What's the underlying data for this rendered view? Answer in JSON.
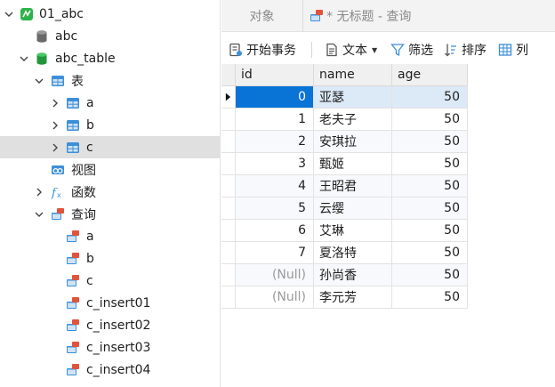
{
  "nav": {
    "items": [
      {
        "label": "01_abc",
        "icon": "connection-icon",
        "indent": 0,
        "expanded": true
      },
      {
        "label": "abc",
        "icon": "database-gray-icon",
        "indent": 1
      },
      {
        "label": "abc_table",
        "icon": "database-green-icon",
        "indent": 1,
        "expanded": true
      },
      {
        "label": "表",
        "icon": "tables-folder-icon",
        "indent": 2,
        "expanded": true
      },
      {
        "label": "a",
        "icon": "table-icon",
        "indent": 3,
        "collapsed": true
      },
      {
        "label": "b",
        "icon": "table-icon",
        "indent": 3,
        "collapsed": true
      },
      {
        "label": "c",
        "icon": "table-icon",
        "indent": 3,
        "collapsed": true,
        "selected": true
      },
      {
        "label": "视图",
        "icon": "views-folder-icon",
        "indent": 2
      },
      {
        "label": "函数",
        "icon": "functions-folder-icon",
        "indent": 2,
        "collapsed": true
      },
      {
        "label": "查询",
        "icon": "queries-folder-icon",
        "indent": 2,
        "expanded": true
      },
      {
        "label": "a",
        "icon": "query-icon",
        "indent": 3
      },
      {
        "label": "b",
        "icon": "query-icon",
        "indent": 3
      },
      {
        "label": "c",
        "icon": "query-icon",
        "indent": 3
      },
      {
        "label": "c_insert01",
        "icon": "query-icon",
        "indent": 3
      },
      {
        "label": "c_insert02",
        "icon": "query-icon",
        "indent": 3
      },
      {
        "label": "c_insert03",
        "icon": "query-icon",
        "indent": 3
      },
      {
        "label": "c_insert04",
        "icon": "query-icon",
        "indent": 3
      }
    ]
  },
  "tabs": {
    "objects": "对象",
    "query": "* 无标题 - 查询"
  },
  "toolbar": {
    "begin_transaction": "开始事务",
    "text": "文本",
    "filter": "筛选",
    "sort": "排序",
    "columns": "列"
  },
  "grid": {
    "columns": [
      "id",
      "name",
      "age"
    ],
    "rows": [
      {
        "id": "0",
        "name": "亚瑟",
        "age": "50"
      },
      {
        "id": "1",
        "name": "老夫子",
        "age": "50"
      },
      {
        "id": "2",
        "name": "安琪拉",
        "age": "50"
      },
      {
        "id": "3",
        "name": "甄姬",
        "age": "50"
      },
      {
        "id": "4",
        "name": "王昭君",
        "age": "50"
      },
      {
        "id": "5",
        "name": "云缨",
        "age": "50"
      },
      {
        "id": "6",
        "name": "艾琳",
        "age": "50"
      },
      {
        "id": "7",
        "name": "夏洛特",
        "age": "50"
      },
      {
        "id": "(Null)",
        "name": "孙尚香",
        "age": "50"
      },
      {
        "id": "(Null)",
        "name": "李元芳",
        "age": "50"
      }
    ]
  },
  "colors": {
    "selection": "#0a74d6",
    "current_row": "#dce9f7",
    "db_green": "#2eb34a",
    "table_blue": "#3d8fd8",
    "query_red": "#e0533c"
  }
}
